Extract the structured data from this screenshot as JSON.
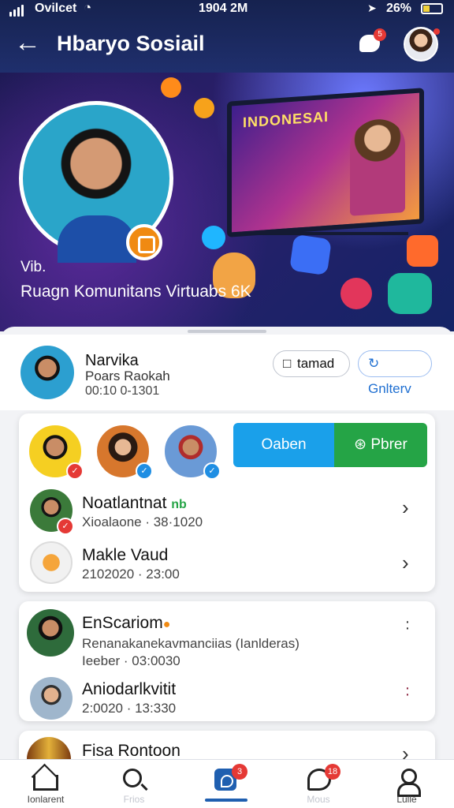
{
  "status_bar": {
    "carrier": "Ovilcet",
    "time": "1904 2M",
    "battery": "26%"
  },
  "header": {
    "title": "Hbaryo Sosiail",
    "notification_count": "5"
  },
  "hero": {
    "tv_title": "INDONESAI",
    "overline": "Vib.",
    "caption": "Ruagn Komunitans Virtuabs 6K"
  },
  "profile": {
    "name": "Narvika",
    "subtitle": "Poars Raokah",
    "date": "00:10 0-1301",
    "button_one": "tamad",
    "button_two": "Gnlterv"
  },
  "segmented": {
    "left_label": "Oaben",
    "right_label": "Pbrer"
  },
  "list_a": [
    {
      "title": "Noatlantnat",
      "tag": "nb",
      "subtitle": "Xioalaone · 38·1020"
    },
    {
      "title": "Makle Vaud",
      "subtitle": "2102020 · 23:00"
    }
  ],
  "list_b": [
    {
      "title": "EnScariom",
      "subtitle": "Renanakanekavmanciias (Ianlderas)",
      "subtitle2": "Ieeber · 03:0030"
    },
    {
      "title": "Aniodarlkvitit",
      "subtitle": "2:0020 · 13:330"
    }
  ],
  "list_c": [
    {
      "title": "Fisa Rontoon"
    }
  ],
  "nav": {
    "items": [
      {
        "label": "Ionlarent",
        "faded": false
      },
      {
        "label": "Frios",
        "faded": true
      },
      {
        "label": "",
        "badge": "3"
      },
      {
        "label": "Mous",
        "faded": true,
        "badge": "18"
      },
      {
        "label": "Lulle",
        "faded": false
      }
    ]
  }
}
